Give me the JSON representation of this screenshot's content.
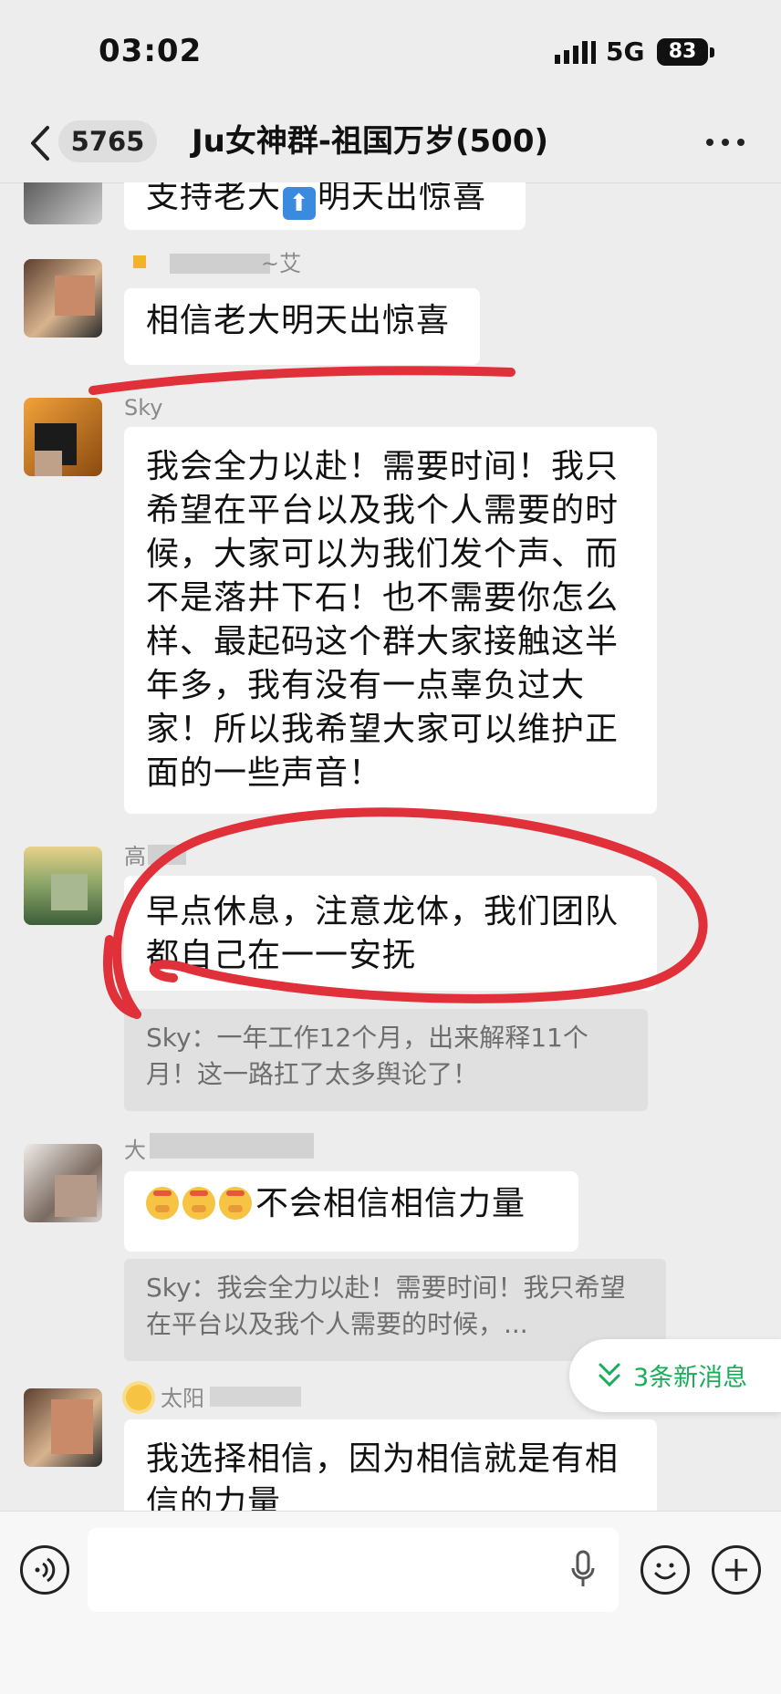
{
  "status_bar": {
    "time": "03:02",
    "network": "5G",
    "battery": "83",
    "signal_icon": "signal-bars-icon"
  },
  "nav": {
    "unread_count": "5765",
    "title": "Ju女神群-祖国万岁(500)",
    "back_icon": "chevron-left-icon",
    "more_icon": "more-dots-icon"
  },
  "messages": [
    {
      "sender": "",
      "text_before": "支持老大",
      "text_after": "明天出惊喜",
      "emoji": "up-arrow-emoji"
    },
    {
      "sender": "~艾",
      "text": "相信老大明天出惊喜"
    },
    {
      "sender": "Sky",
      "text": "我会全力以赴！需要时间！我只希望在平台以及我个人需要的时候，大家可以为我们发个声、而不是落井下石！也不需要你怎么样、最起码这个群大家接触这半年多，我有没有一点辜负过大家！所以我希望大家可以维护正面的一些声音！"
    },
    {
      "sender": "高",
      "text": "早点休息，注意龙体，我们团队都自己在一一安抚",
      "quote": "Sky：一年工作12个月，出来解释11个月！这一路扛了太多舆论了！"
    },
    {
      "sender": "大",
      "text": "不会相信相信力量",
      "emoji": "saluting-face-emoji",
      "quote": "Sky：我会全力以赴！需要时间！我只希望在平台以及我个人需要的时候，..."
    },
    {
      "sender": "太阳",
      "text": "我选择相信，因为相信就是有相信的力量"
    }
  ],
  "new_messages_chip": {
    "label": "3条新消息",
    "icon": "double-chevron-down-icon",
    "color": "#1aad5a"
  },
  "input_bar": {
    "voice_icon": "voice-icon",
    "mic_icon": "microphone-icon",
    "emoji_icon": "smiley-icon",
    "plus_icon": "plus-icon"
  },
  "annotation_color": "#e0303a"
}
